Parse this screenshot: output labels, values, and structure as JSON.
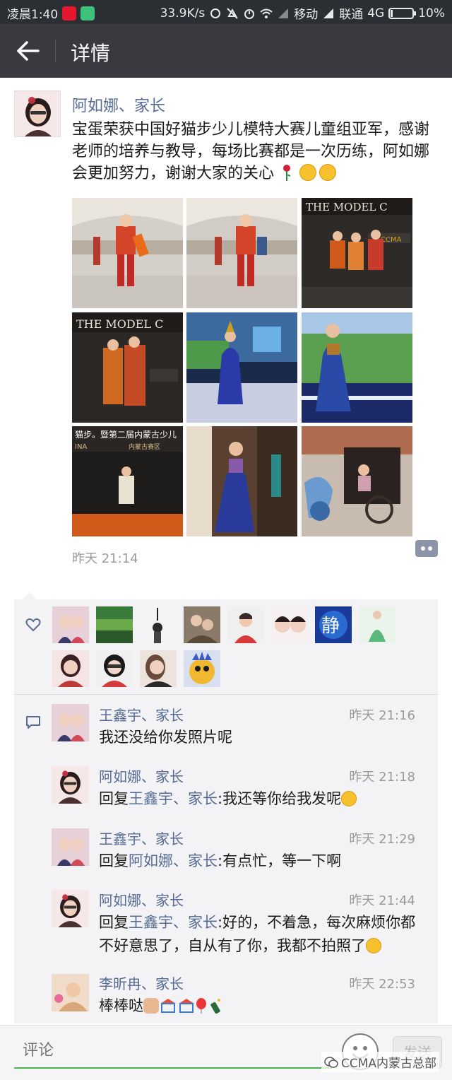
{
  "status_bar": {
    "time": "凌晨1:40",
    "app_icons": [
      "weibo-icon",
      "meituan-icon"
    ],
    "net_speed": "33.9K/s",
    "carrier1": "移动",
    "carrier2": "联通",
    "net_type": "4G",
    "battery": "10%",
    "battery_level": 0.1
  },
  "header": {
    "title": "详情",
    "back_icon": "back-arrow-icon"
  },
  "post": {
    "author": "阿如娜、家长",
    "text": "宝蛋荣获中国好猫步少儿模特大赛儿童组亚军，感谢老师的培养与教导，每场比赛都是一次历练，阿如娜会更加努力，谢谢大家的关心",
    "emojis": [
      "rose-icon",
      "kiss-face-icon",
      "kiss-face-icon"
    ],
    "time": "昨天 21:14",
    "photo_texts": {
      "banner_model": "THE MODEL C",
      "banner_model2": "THE MODEL C",
      "banner_contest": "猫步。暨第二届内蒙古少儿",
      "banner_region": "内蒙古赛区",
      "banner_ina": "INA",
      "sponsor_ccma": "CCMA"
    }
  },
  "likes": {
    "icon": "heart-icon",
    "count_avatars": 13
  },
  "comments": {
    "icon": "comment-icon",
    "items": [
      {
        "name": "王鑫宇、家长",
        "time": "昨天 21:16",
        "reply_prefix": "",
        "reply_to": "",
        "text": "我还没给你发照片呢"
      },
      {
        "name": "阿如娜、家长",
        "time": "昨天 21:18",
        "reply_prefix": "回复",
        "reply_to": "王鑫宇、家长",
        "text": ":我还等你给我发呢"
      },
      {
        "name": "王鑫宇、家长",
        "time": "昨天 21:29",
        "reply_prefix": "回复",
        "reply_to": "阿如娜、家长",
        "text": ":有点忙，等一下啊"
      },
      {
        "name": "阿如娜、家长",
        "time": "昨天 21:44",
        "reply_prefix": "回复",
        "reply_to": "王鑫宇、家长",
        "text": ":好的，不着急，每次麻烦你都不好意思了，自从有了你，我都不拍照了"
      },
      {
        "name": "李昕冉、家长",
        "time": "昨天 22:53",
        "reply_prefix": "",
        "reply_to": "",
        "text": "棒棒哒"
      }
    ]
  },
  "input_bar": {
    "placeholder": "评论",
    "send_label": "发送",
    "emoji_icon": "smiley-face-icon"
  },
  "watermark": {
    "text": "CCMA内蒙古总部"
  }
}
